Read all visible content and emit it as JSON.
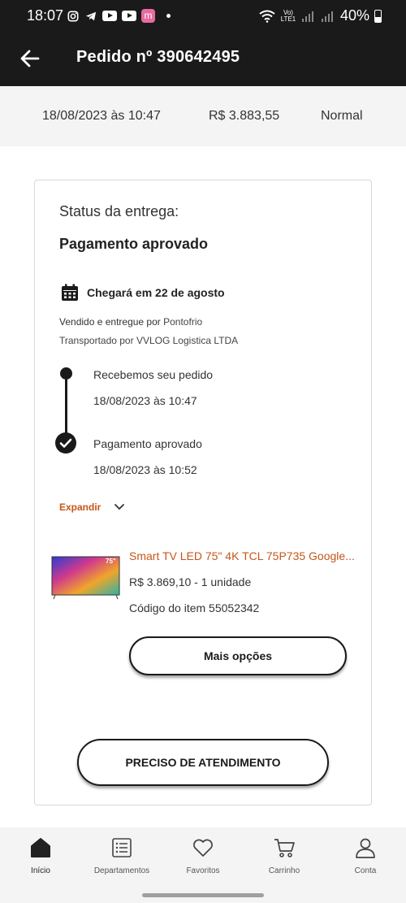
{
  "status_bar": {
    "time": "18:07",
    "network_label": "Vo) LTE1",
    "battery": "40%",
    "app_badge": "m"
  },
  "header": {
    "title": "Pedido nº 390642495"
  },
  "summary": {
    "date": "18/08/2023 às 10:47",
    "total": "R$ 3.883,55",
    "shipping_type": "Normal"
  },
  "delivery": {
    "status_label": "Status da entrega:",
    "status_value": "Pagamento aprovado",
    "arrival": "Chegará em 22 de agosto",
    "sold_label": "Vendido e entregue por",
    "sold_by": "Pontofrio",
    "carrier_label": "Transportado por",
    "carrier": "VVLOG Logistica LTDA",
    "timeline": [
      {
        "title": "Recebemos seu pedido",
        "date": "18/08/2023 às 10:47"
      },
      {
        "title": "Pagamento aprovado",
        "date": "18/08/2023 às 10:52"
      }
    ],
    "expand_label": "Expandir"
  },
  "product": {
    "name": "Smart TV LED 75\" 4K TCL 75P735 Google...",
    "price_qty": "R$ 3.869,10 - 1 unidade",
    "code": "Código do item 55052342",
    "image_badge": "75\""
  },
  "buttons": {
    "more_options": "Mais opções",
    "help": "PRECISO DE ATENDIMENTO"
  },
  "nav": {
    "items": [
      {
        "label": "Início",
        "icon": "home-icon",
        "active": true
      },
      {
        "label": "Departamentos",
        "icon": "list-icon",
        "active": false
      },
      {
        "label": "Favoritos",
        "icon": "heart-icon",
        "active": false
      },
      {
        "label": "Carrinho",
        "icon": "cart-icon",
        "active": false
      },
      {
        "label": "Conta",
        "icon": "user-icon",
        "active": false
      }
    ]
  },
  "colors": {
    "accent": "#c4571a",
    "dark": "#1a1a1a"
  }
}
